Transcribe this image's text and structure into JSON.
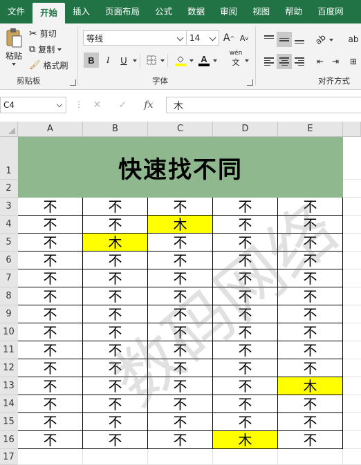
{
  "menu": {
    "tabs": [
      "文件",
      "开始",
      "插入",
      "页面布局",
      "公式",
      "数据",
      "审阅",
      "视图",
      "帮助",
      "百度网"
    ],
    "active_index": 1
  },
  "ribbon": {
    "clipboard": {
      "paste_label": "粘贴",
      "cut_label": "剪切",
      "copy_label": "复制",
      "format_painter_label": "格式刷",
      "group_label": "剪贴板"
    },
    "font": {
      "font_name": "等线",
      "font_size": "14",
      "grow_label": "A",
      "shrink_label": "A",
      "bold_label": "B",
      "italic_label": "I",
      "underline_label": "U",
      "phonetic_label": "wén",
      "group_label": "字体"
    },
    "alignment": {
      "group_label": "对齐方式"
    }
  },
  "formula_bar": {
    "name_box": "C4",
    "fx_label": "fx",
    "formula_value": "木"
  },
  "sheet": {
    "columns": [
      "A",
      "B",
      "C",
      "D",
      "E"
    ],
    "rows": [
      "1",
      "2",
      "3",
      "4",
      "5",
      "6",
      "7",
      "8",
      "9",
      "10",
      "11",
      "12",
      "13",
      "14",
      "15",
      "16",
      "17"
    ],
    "title": "快速找不同",
    "grid": [
      [
        "不",
        "不",
        "不",
        "不",
        "不"
      ],
      [
        "不",
        "不",
        "木",
        "不",
        "不"
      ],
      [
        "不",
        "木",
        "不",
        "不",
        "不"
      ],
      [
        "不",
        "不",
        "不",
        "不",
        "不"
      ],
      [
        "不",
        "不",
        "不",
        "不",
        "不"
      ],
      [
        "不",
        "不",
        "不",
        "不",
        "不"
      ],
      [
        "不",
        "不",
        "不",
        "不",
        "不"
      ],
      [
        "不",
        "不",
        "不",
        "不",
        "不"
      ],
      [
        "不",
        "不",
        "不",
        "不",
        "不"
      ],
      [
        "不",
        "不",
        "不",
        "不",
        "不"
      ],
      [
        "不",
        "不",
        "不",
        "不",
        "木"
      ],
      [
        "不",
        "不",
        "不",
        "不",
        "不"
      ],
      [
        "不",
        "不",
        "不",
        "不",
        "不"
      ],
      [
        "不",
        "不",
        "不",
        "木",
        "不"
      ]
    ],
    "highlight_cells": [
      "C4",
      "B5",
      "E13",
      "D16"
    ],
    "highlight_color": "#ffff00",
    "title_fill_color": "#8fb88f",
    "watermark": "数码网络"
  },
  "colors": {
    "accent": "#217346"
  }
}
